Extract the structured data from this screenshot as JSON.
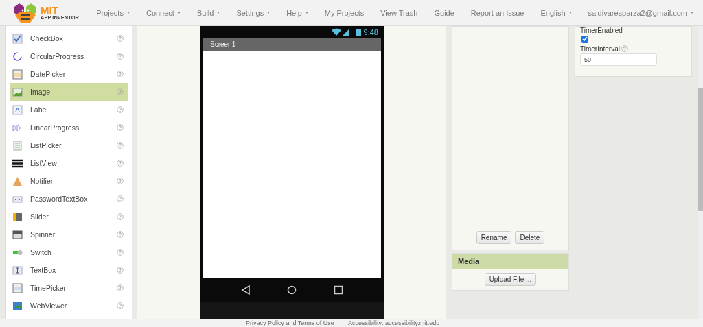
{
  "header": {
    "logo": {
      "title": "MIT",
      "subtitle": "APP INVENTOR"
    },
    "menus": [
      {
        "label": "Projects",
        "dropdown": true
      },
      {
        "label": "Connect",
        "dropdown": true
      },
      {
        "label": "Build",
        "dropdown": true
      },
      {
        "label": "Settings",
        "dropdown": true
      },
      {
        "label": "Help",
        "dropdown": true
      }
    ],
    "links": [
      {
        "label": "My Projects",
        "dropdown": false
      },
      {
        "label": "View Trash",
        "dropdown": false
      },
      {
        "label": "Guide",
        "dropdown": false
      },
      {
        "label": "Report an Issue",
        "dropdown": false
      },
      {
        "label": "English",
        "dropdown": true
      },
      {
        "label": "saldivaresparza2@gmail.com",
        "dropdown": true
      }
    ]
  },
  "palette": {
    "items": [
      {
        "label": "CheckBox",
        "kind": "checkbox",
        "selected": false
      },
      {
        "label": "CircularProgress",
        "kind": "circular",
        "selected": false
      },
      {
        "label": "DatePicker",
        "kind": "datepicker",
        "selected": false
      },
      {
        "label": "Image",
        "kind": "image",
        "selected": true
      },
      {
        "label": "Label",
        "kind": "label",
        "selected": false
      },
      {
        "label": "LinearProgress",
        "kind": "linear",
        "selected": false
      },
      {
        "label": "ListPicker",
        "kind": "listpicker",
        "selected": false
      },
      {
        "label": "ListView",
        "kind": "listview",
        "selected": false
      },
      {
        "label": "Notifier",
        "kind": "notifier",
        "selected": false
      },
      {
        "label": "PasswordTextBox",
        "kind": "password",
        "selected": false
      },
      {
        "label": "Slider",
        "kind": "slider",
        "selected": false
      },
      {
        "label": "Spinner",
        "kind": "spinner",
        "selected": false
      },
      {
        "label": "Switch",
        "kind": "switch",
        "selected": false
      },
      {
        "label": "TextBox",
        "kind": "textbox",
        "selected": false
      },
      {
        "label": "TimePicker",
        "kind": "timepicker",
        "selected": false
      },
      {
        "label": "WebViewer",
        "kind": "webviewer",
        "selected": false
      }
    ]
  },
  "viewer": {
    "status_time": "9:48",
    "screen_title": "Screen1"
  },
  "components": {
    "buttons": [
      "Rename",
      "Delete"
    ]
  },
  "media": {
    "title": "Media",
    "upload_button": "Upload File ..."
  },
  "properties": [
    {
      "kind": "checkbox",
      "label": "TimerEnabled",
      "help": false,
      "checked": true
    },
    {
      "kind": "text",
      "label": "TimerInterval",
      "help": true,
      "value": "50"
    }
  ],
  "footer": [
    "Privacy Policy and Terms of Use",
    "Accessibility: accessibility.mit.edu"
  ]
}
